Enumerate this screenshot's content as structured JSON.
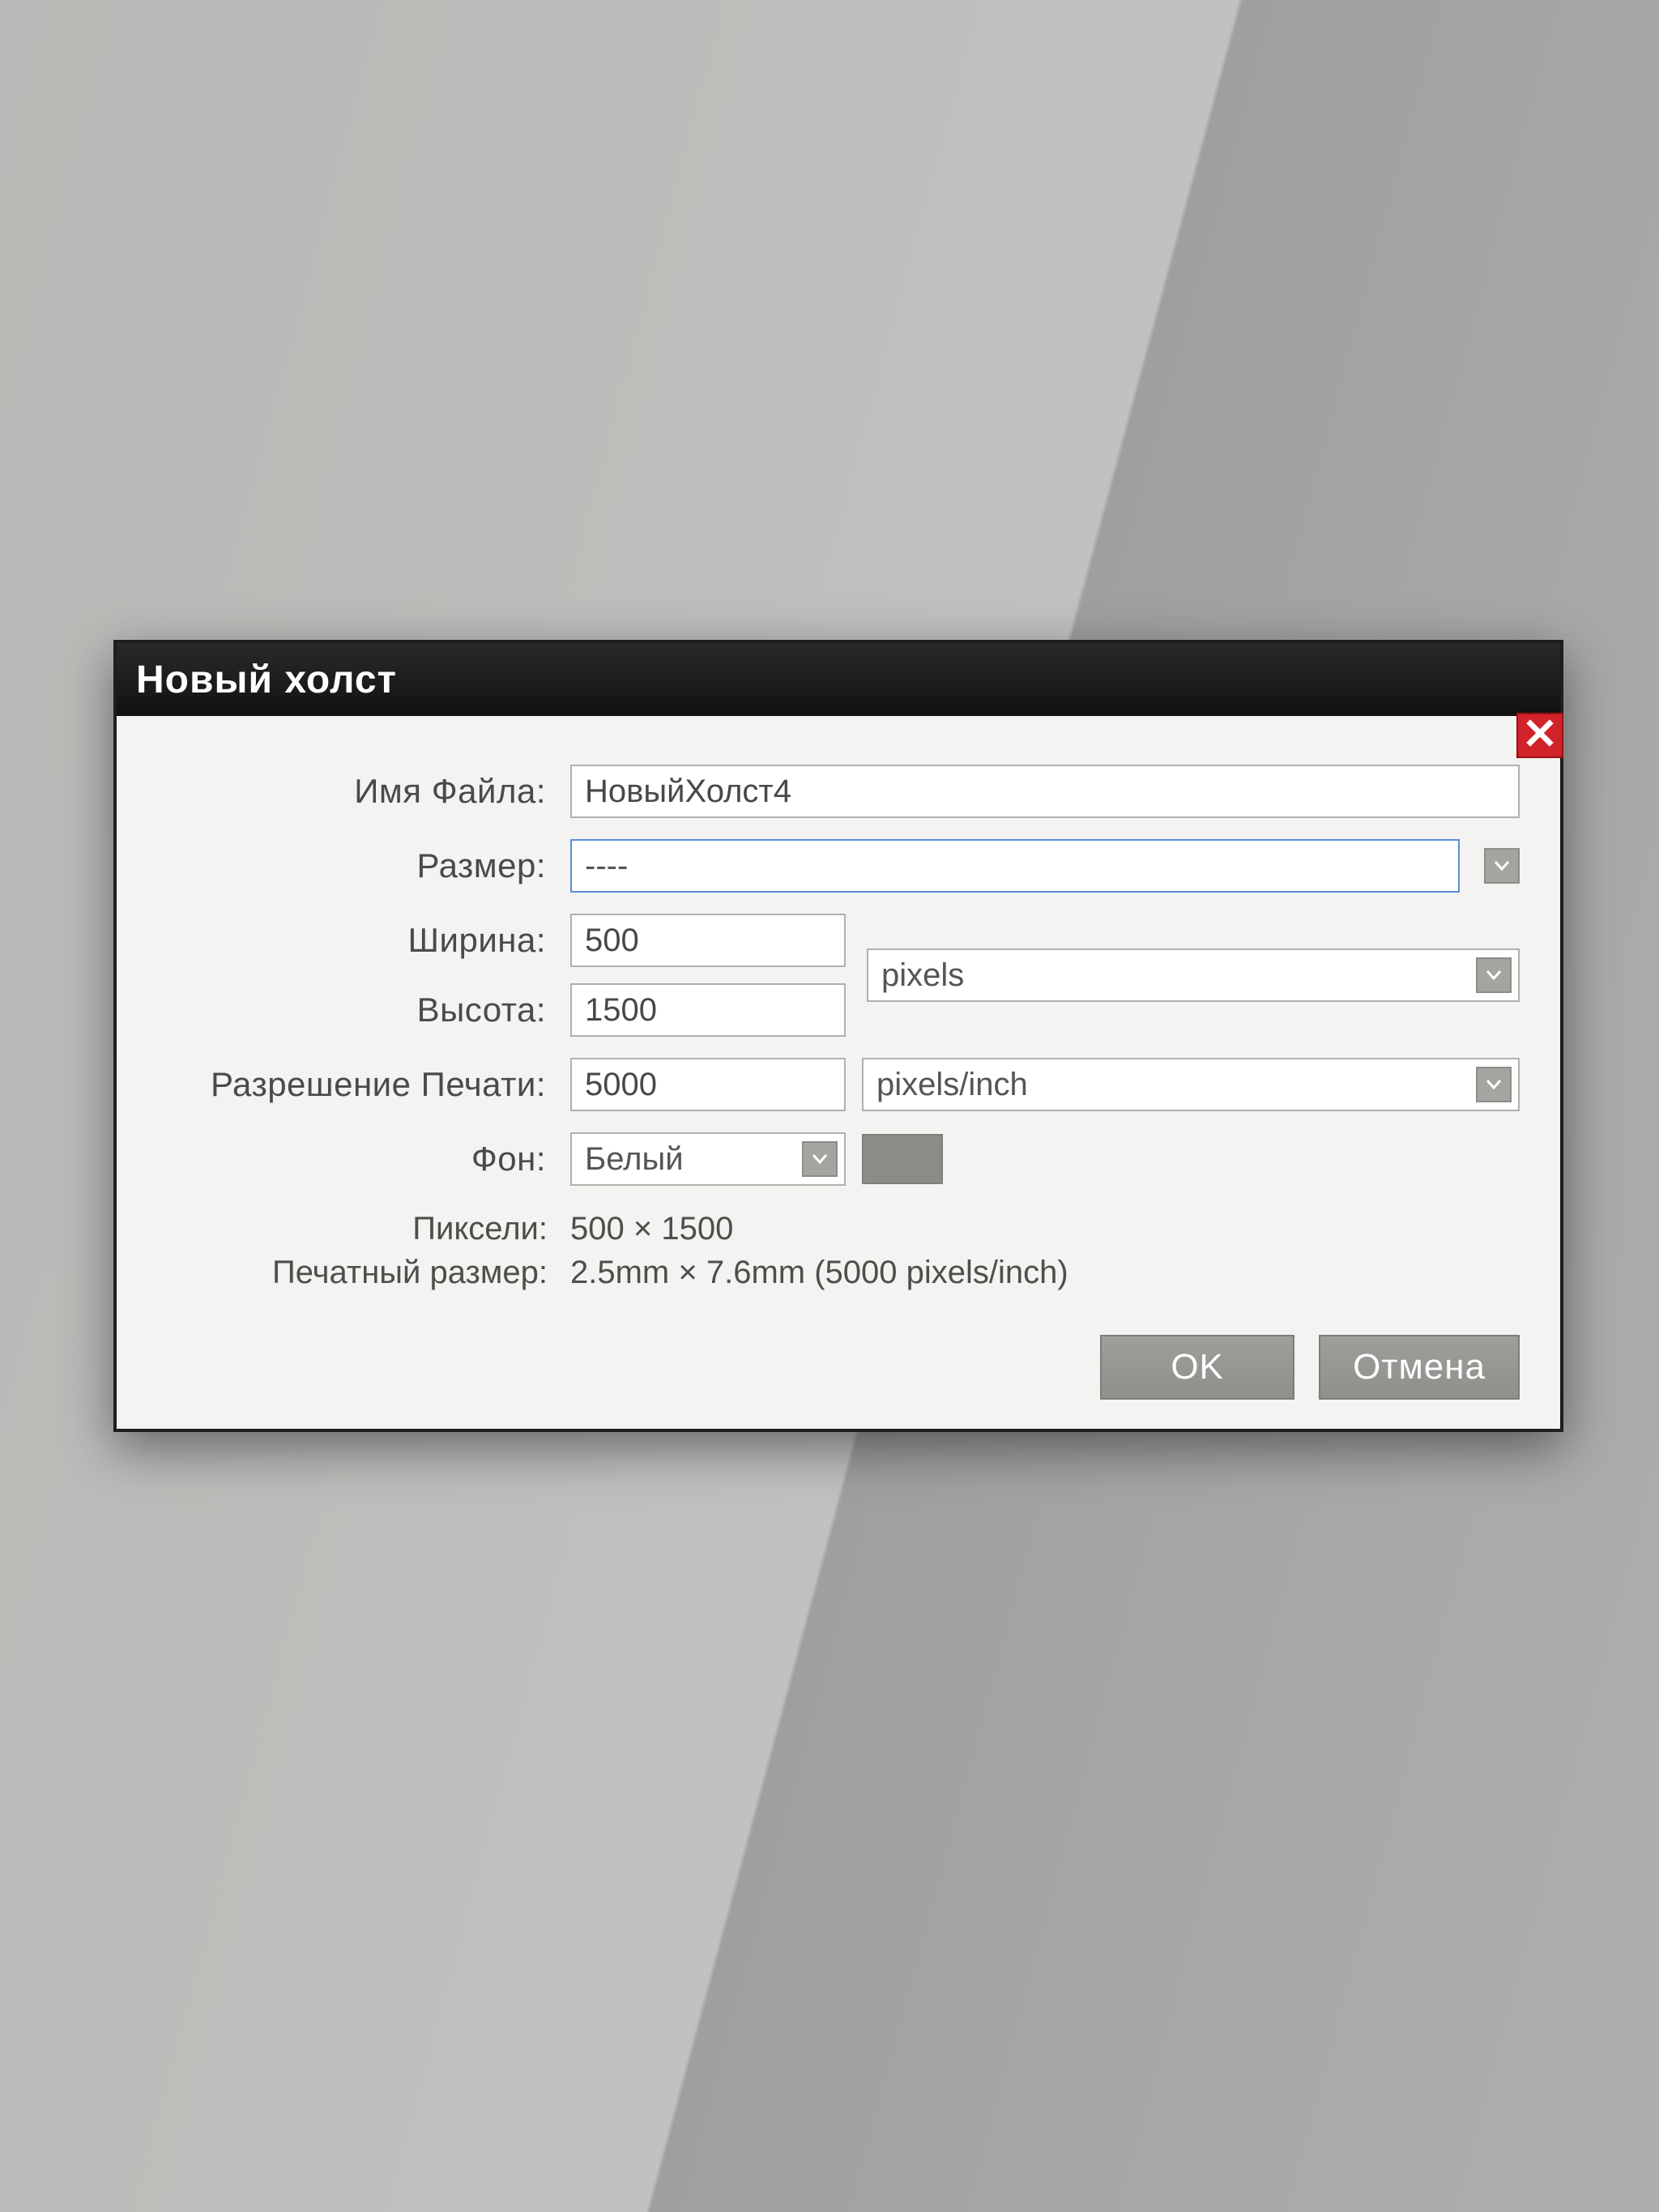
{
  "dialog": {
    "title": "Новый холст",
    "close_icon_label": "×"
  },
  "fields": {
    "filename_label": "Имя Файла:",
    "filename_value": "НовыйХолст4",
    "size_label": "Размер:",
    "size_value": "----",
    "width_label": "Ширина:",
    "width_value": "500",
    "height_label": "Высота:",
    "height_value": "1500",
    "dim_unit": "pixels",
    "resolution_label": "Разрешение Печати:",
    "resolution_value": "5000",
    "resolution_unit": "pixels/inch",
    "background_label": "Фон:",
    "background_value": "Белый"
  },
  "summary": {
    "pixels_label": "Пиксели:",
    "pixels_value": "500 × 1500",
    "print_label": "Печатный размер:",
    "print_value": "2.5mm × 7.6mm (5000 pixels/inch)"
  },
  "buttons": {
    "ok": "OK",
    "cancel": "Отмена"
  }
}
